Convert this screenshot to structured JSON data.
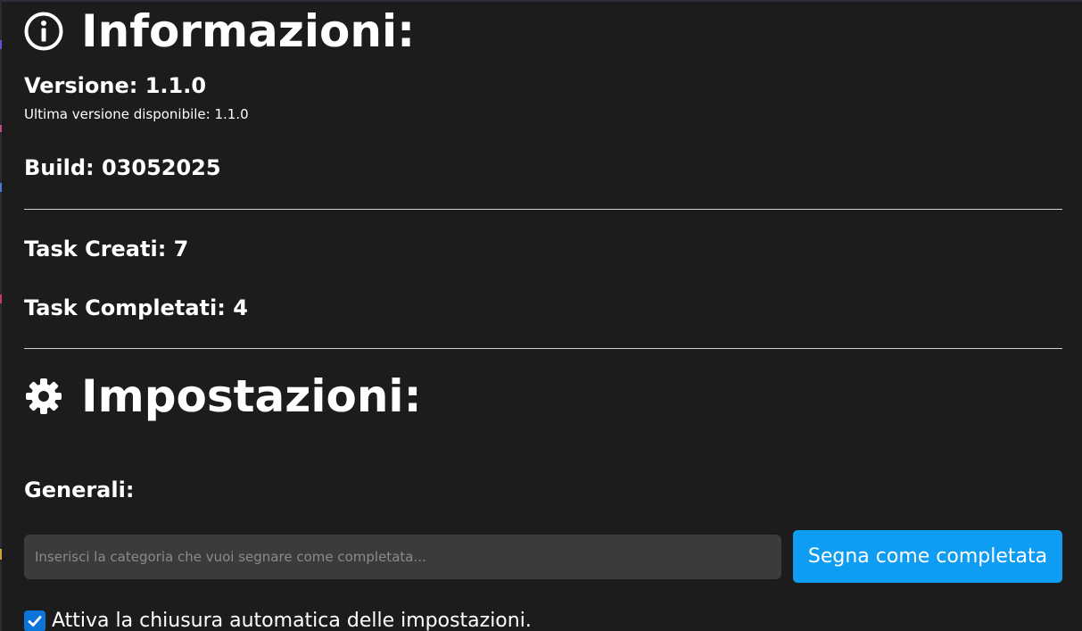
{
  "info": {
    "title": "Informazioni:",
    "version": "Versione: 1.1.0",
    "latest_version": "Ultima versione disponibile: 1.1.0",
    "build": "Build: 03052025",
    "tasks_created": "Task Creati: 7",
    "tasks_completed": "Task Completati: 4"
  },
  "settings": {
    "title": "Impostazioni:",
    "general_heading": "Generali:",
    "category_input": {
      "placeholder": "Inserisci la categoria che vuoi segnare come completata...",
      "value": ""
    },
    "mark_button_label": "Segna come completata",
    "auto_close": {
      "label": "Attiva la chiusura automatica delle impostazioni.",
      "checked": true
    }
  },
  "colors": {
    "background": "#1c1c1c",
    "text": "#ffffff",
    "input_background": "#3b3b3b",
    "button_accent": "#0f9cf3",
    "checkbox_accent": "#0a74d9",
    "divider": "#cfcfcf"
  },
  "icons": {
    "info": "info-circle-icon",
    "settings": "gear-icon",
    "checkbox": "checkmark-icon"
  }
}
